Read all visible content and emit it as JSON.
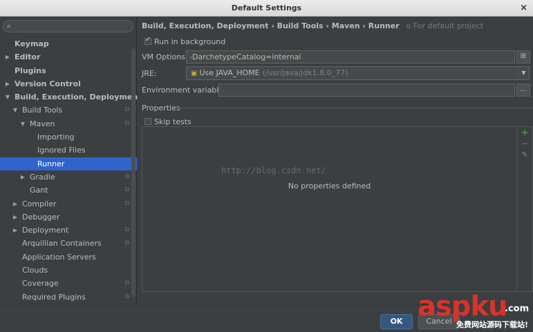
{
  "window": {
    "title": "Default Settings",
    "close_glyph": "×"
  },
  "search": {
    "placeholder": "",
    "icon": "search-icon"
  },
  "tree": [
    {
      "label": "Keymap",
      "level": 0,
      "bold": true,
      "arrow": "",
      "copy": false,
      "selected": false
    },
    {
      "label": "Editor",
      "level": 0,
      "bold": true,
      "arrow": "▶",
      "copy": false,
      "selected": false
    },
    {
      "label": "Plugins",
      "level": 0,
      "bold": true,
      "arrow": "",
      "copy": false,
      "selected": false
    },
    {
      "label": "Version Control",
      "level": 0,
      "bold": true,
      "arrow": "▶",
      "copy": false,
      "selected": false
    },
    {
      "label": "Build, Execution, Deployment",
      "level": 0,
      "bold": true,
      "arrow": "▼",
      "copy": false,
      "selected": false
    },
    {
      "label": "Build Tools",
      "level": 1,
      "bold": false,
      "arrow": "▼",
      "copy": true,
      "selected": false
    },
    {
      "label": "Maven",
      "level": 2,
      "bold": false,
      "arrow": "▼",
      "copy": true,
      "selected": false
    },
    {
      "label": "Importing",
      "level": 3,
      "bold": false,
      "arrow": "",
      "copy": false,
      "selected": false
    },
    {
      "label": "Ignored Files",
      "level": 3,
      "bold": false,
      "arrow": "",
      "copy": false,
      "selected": false
    },
    {
      "label": "Runner",
      "level": 3,
      "bold": false,
      "arrow": "",
      "copy": false,
      "selected": true
    },
    {
      "label": "Gradle",
      "level": 2,
      "bold": false,
      "arrow": "▶",
      "copy": true,
      "selected": false
    },
    {
      "label": "Gant",
      "level": 2,
      "bold": false,
      "arrow": "",
      "copy": true,
      "selected": false
    },
    {
      "label": "Compiler",
      "level": 1,
      "bold": false,
      "arrow": "▶",
      "copy": true,
      "selected": false
    },
    {
      "label": "Debugger",
      "level": 1,
      "bold": false,
      "arrow": "▶",
      "copy": false,
      "selected": false
    },
    {
      "label": "Deployment",
      "level": 1,
      "bold": false,
      "arrow": "▶",
      "copy": true,
      "selected": false
    },
    {
      "label": "Arquillian Containers",
      "level": 1,
      "bold": false,
      "arrow": "",
      "copy": true,
      "selected": false
    },
    {
      "label": "Application Servers",
      "level": 1,
      "bold": false,
      "arrow": "",
      "copy": false,
      "selected": false
    },
    {
      "label": "Clouds",
      "level": 1,
      "bold": false,
      "arrow": "",
      "copy": false,
      "selected": false
    },
    {
      "label": "Coverage",
      "level": 1,
      "bold": false,
      "arrow": "",
      "copy": true,
      "selected": false
    },
    {
      "label": "Required Plugins",
      "level": 1,
      "bold": false,
      "arrow": "",
      "copy": true,
      "selected": false
    }
  ],
  "breadcrumb": {
    "path": "Build, Execution, Deployment › Build Tools › Maven › Runner",
    "hint": "For default project"
  },
  "run_in_background": {
    "label": "Run in background",
    "checked": true
  },
  "vm_options": {
    "label": "VM Options:",
    "value": "-DarchetypeCatalog=internal"
  },
  "jre": {
    "label": "JRE:",
    "value": "Use JAVA_HOME",
    "path": "(/usr/java/jdk1.8.0_77)"
  },
  "env_vars": {
    "label": "Environment variables:",
    "value": "",
    "button": "..."
  },
  "properties": {
    "title": "Properties",
    "empty_text": "No properties defined",
    "watermark": "http://blog.csdn.net/"
  },
  "skip_tests": {
    "label": "Skip tests",
    "checked": false
  },
  "buttons": {
    "ok": "OK",
    "cancel": "Cancel"
  },
  "logo": {
    "brand_asp": "asp",
    "brand_ku": "ku",
    "brand_com": ".com",
    "tagline": "免费网站源码下载站!"
  },
  "colors": {
    "selection": "#2f65ca",
    "add": "#499c54",
    "logo": "#d8332b"
  }
}
